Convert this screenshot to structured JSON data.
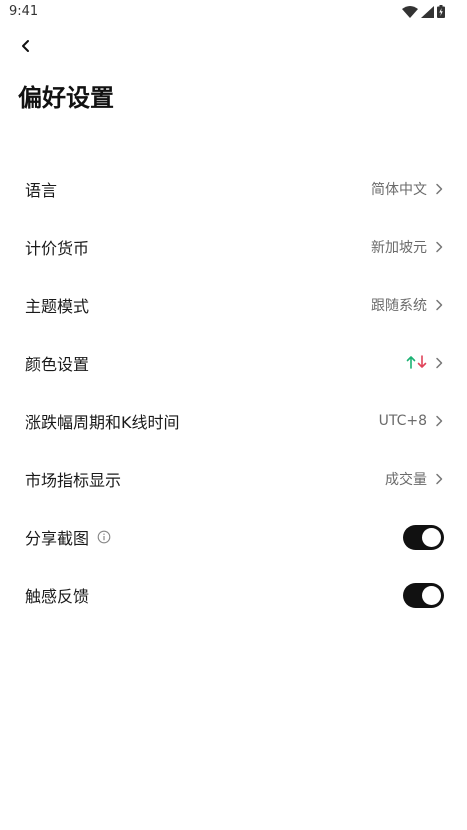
{
  "status_bar": {
    "time": "9:41"
  },
  "header": {
    "title": "偏好设置"
  },
  "settings": {
    "language": {
      "label": "语言",
      "value": "简体中文"
    },
    "currency": {
      "label": "计价货币",
      "value": "新加坡元"
    },
    "theme": {
      "label": "主题模式",
      "value": "跟随系统"
    },
    "color": {
      "label": "颜色设置",
      "up_color": "#1bb273",
      "down_color": "#e0445a"
    },
    "timezone": {
      "label": "涨跌幅周期和K线时间",
      "value": "UTC+8"
    },
    "market_indicator": {
      "label": "市场指标显示",
      "value": "成交量"
    },
    "share_screenshot": {
      "label": "分享截图",
      "enabled": true
    },
    "haptic": {
      "label": "触感反馈",
      "enabled": true
    }
  },
  "colors": {
    "toggle_on": "#111111",
    "value_text": "#6b6b6b"
  }
}
